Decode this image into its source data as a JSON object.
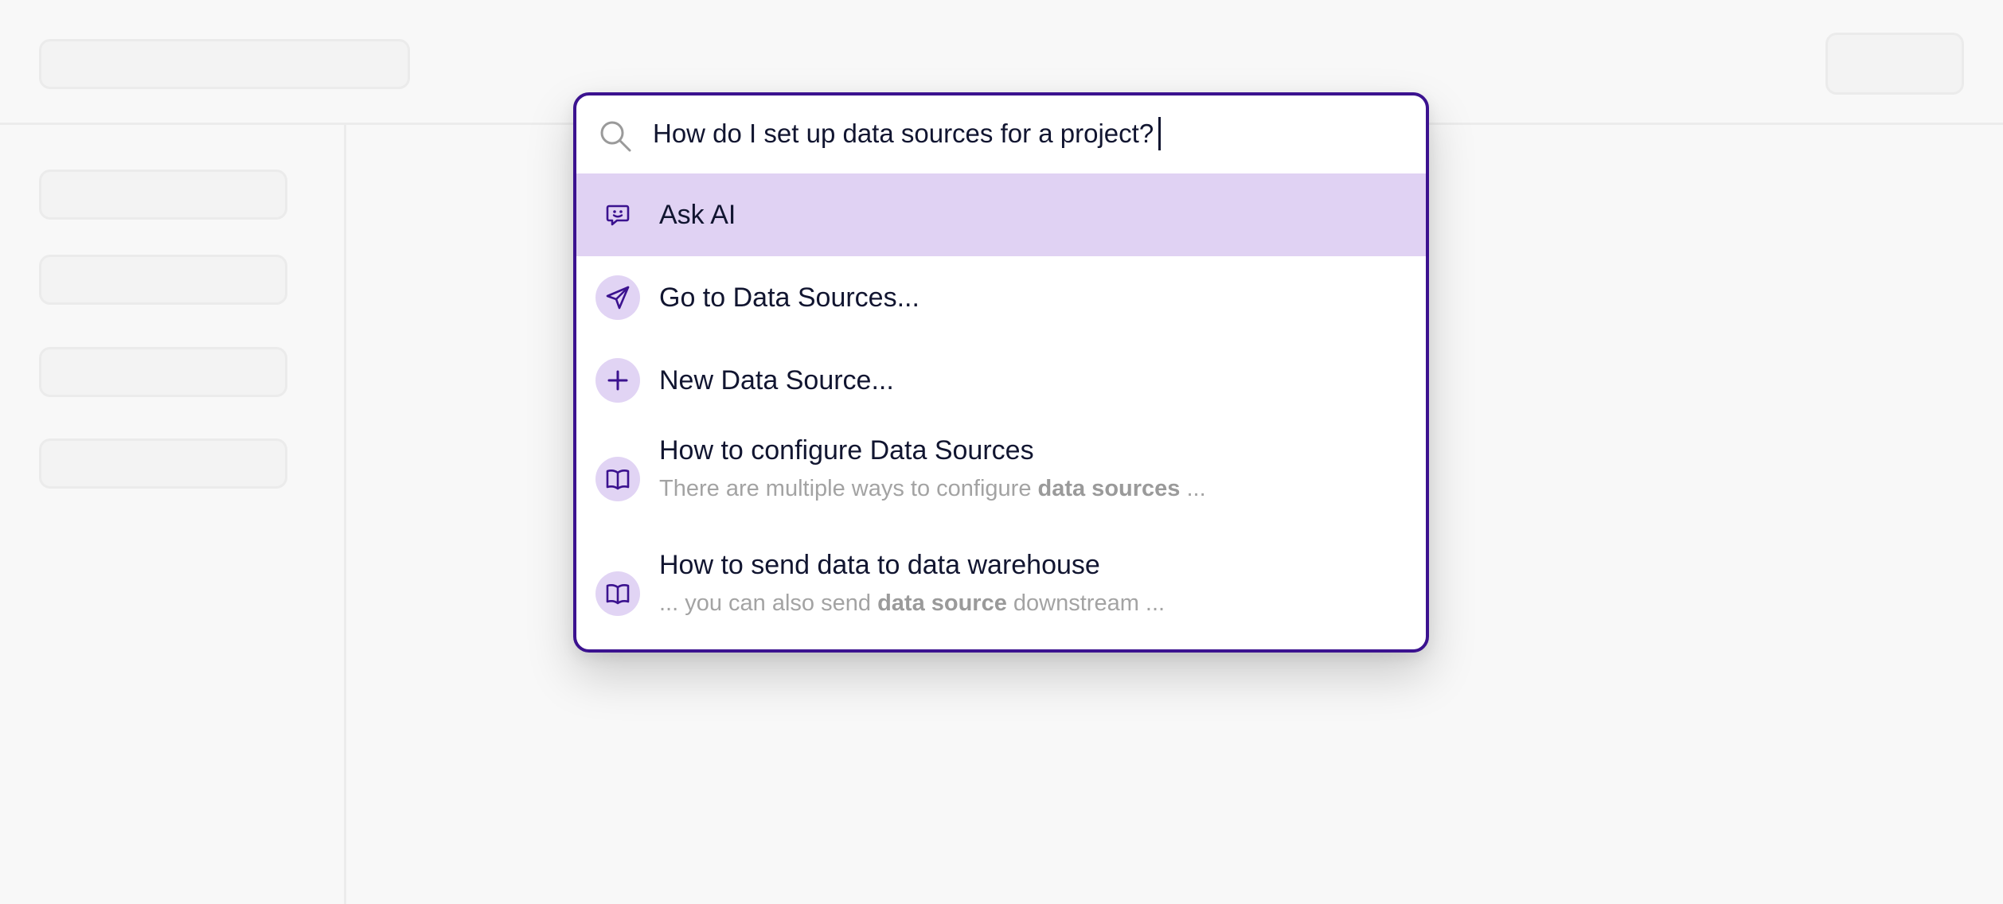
{
  "search": {
    "value": "How do I set up data sources for a project?"
  },
  "results": [
    {
      "icon": "chat-bot-icon",
      "title": "Ask AI",
      "active": true
    },
    {
      "icon": "navigate-arrow-icon",
      "title": "Go to Data Sources..."
    },
    {
      "icon": "plus-icon",
      "title": "New Data Source..."
    },
    {
      "icon": "book-icon",
      "title": "How to configure Data Sources",
      "snippet_before": "There are multiple ways to configure ",
      "snippet_bold": "data sources",
      "snippet_after": " ..."
    },
    {
      "icon": "book-icon",
      "title": "How to send data to data warehouse",
      "snippet_before": "... you can also send ",
      "snippet_bold": "data source",
      "snippet_after": " downstream ..."
    }
  ],
  "colors": {
    "accent": "#3b128f",
    "highlight": "#e0d2f3",
    "icon_bg": "#e1d4f4",
    "text": "#111530",
    "muted": "#a3a3a3"
  }
}
